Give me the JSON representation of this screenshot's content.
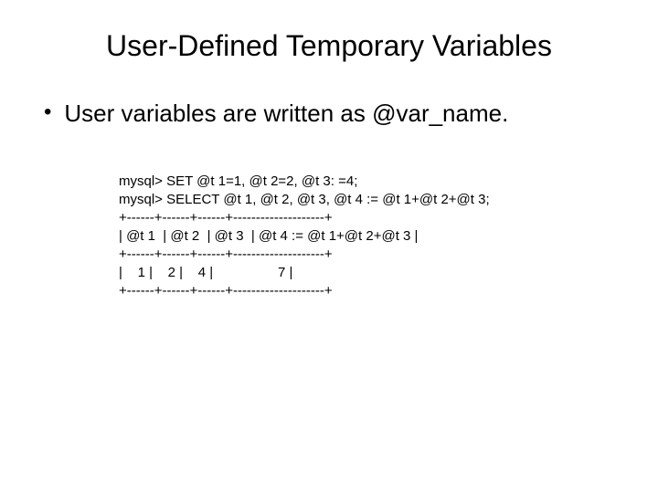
{
  "title": "User-Defined Temporary Variables",
  "bullet": "User variables are written as @var_name.",
  "code": {
    "line1": "mysql> SET @t 1=1, @t 2=2, @t 3: =4;",
    "line2": "mysql> SELECT @t 1, @t 2, @t 3, @t 4 := @t 1+@t 2+@t 3;",
    "line3": "+------+------+------+--------------------+",
    "line4": "| @t 1  | @t 2  | @t 3  | @t 4 := @t 1+@t 2+@t 3 |",
    "line5": "+------+------+------+--------------------+",
    "line6": "|    1 |    2 |    4 |                 7 |",
    "line7": "+------+------+------+--------------------+"
  }
}
